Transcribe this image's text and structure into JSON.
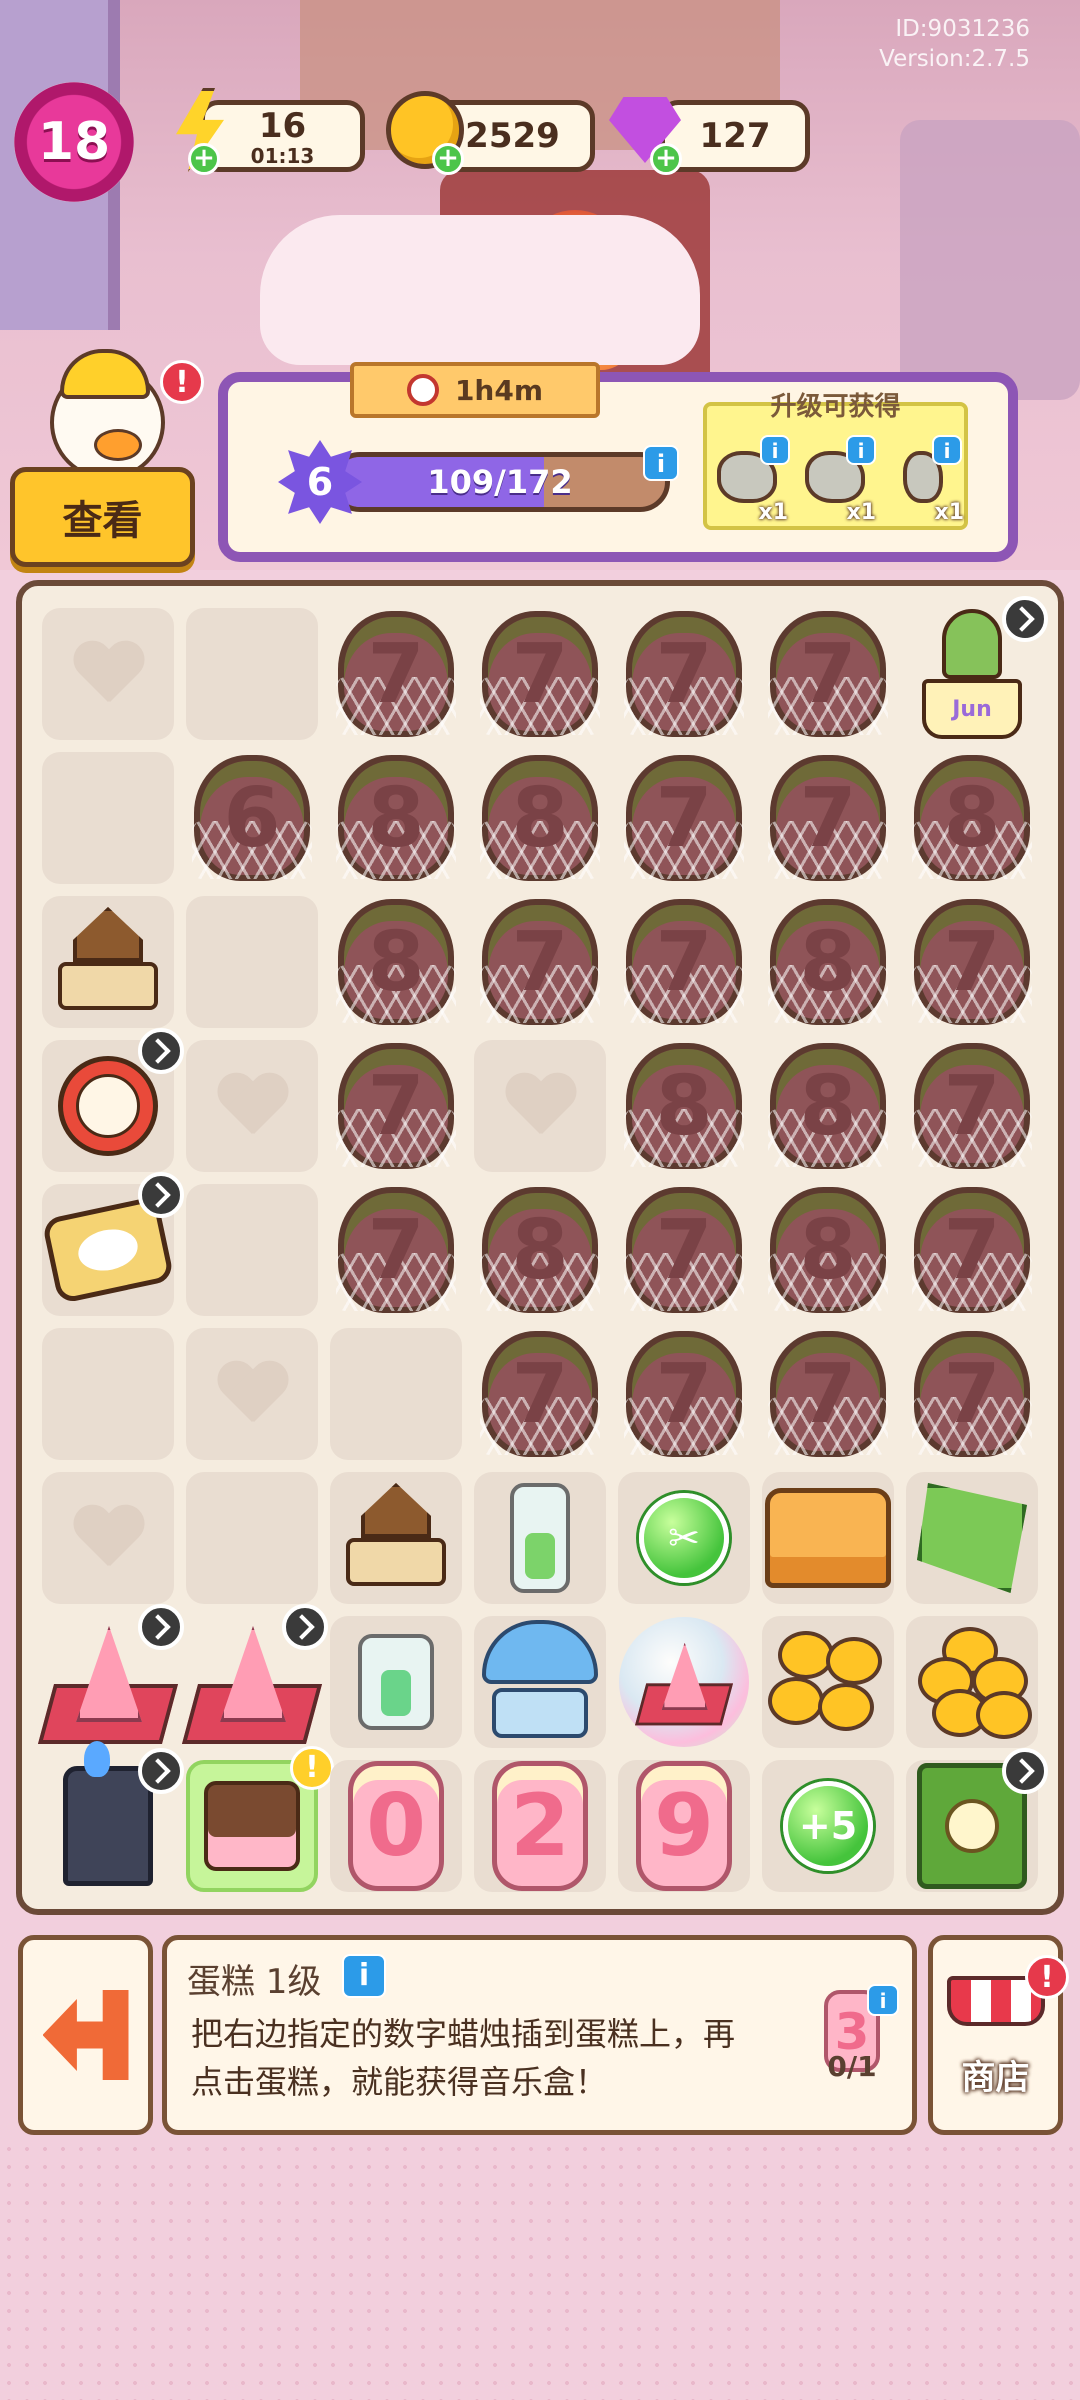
{
  "account": {
    "id_text": "ID:9031236",
    "version_text": "Version:2.7.5"
  },
  "topbar": {
    "level": "18",
    "energy": {
      "value": "16",
      "timer": "01:13"
    },
    "coins": "2529",
    "gems": "127"
  },
  "order": {
    "view_button": "查看",
    "timer": "1h4m",
    "level": "6",
    "progress_text": "109/172",
    "progress_fraction": 0.634,
    "reward_title": "升级可获得",
    "rewards": [
      {
        "qty": "x1",
        "icon": "rock-icon"
      },
      {
        "qty": "x1",
        "icon": "rock-pile-icon"
      },
      {
        "qty": "x1",
        "icon": "stone-ruin-icon"
      }
    ]
  },
  "board": {
    "locked_candles": [
      [
        "",
        "",
        "7",
        "7",
        "7",
        "7",
        ""
      ],
      [
        "",
        "6",
        "8",
        "8",
        "7",
        "7",
        "8"
      ],
      [
        "",
        "",
        "8",
        "7",
        "7",
        "8",
        "7"
      ],
      [
        "",
        "",
        "7",
        "",
        "8",
        "8",
        "7"
      ],
      [
        "",
        "",
        "7",
        "8",
        "7",
        "8",
        "7"
      ],
      [
        "",
        "",
        "",
        "7",
        "7",
        "7",
        "7"
      ]
    ],
    "bottom_candles": [
      "0",
      "2",
      "9"
    ],
    "energy_bubble": "+5",
    "cactus_pot_text": "Jun"
  },
  "info_panel": {
    "title": "蛋糕 1级",
    "description": "把右边指定的数字蜡烛插到蛋糕上，再点击蛋糕，就能获得音乐盒！",
    "target_candle": "3",
    "target_count": "0/1",
    "shop_label": "商店"
  },
  "colors": {
    "accent_purple": "#8d56b5",
    "progress_purple": "#8f66e6",
    "background_pink": "#f2cfdd"
  }
}
